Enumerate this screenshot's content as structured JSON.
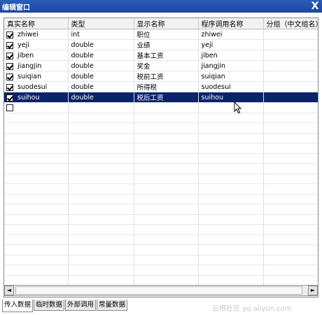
{
  "window": {
    "title": "编辑窗口",
    "close_glyph": "X"
  },
  "grid": {
    "columns": [
      "真实名称",
      "类型",
      "显示名称",
      "程序调用名称",
      "分组（中文组名）"
    ],
    "rows": [
      {
        "checked": true,
        "real_name": "zhiwei",
        "type": "int",
        "display_name": "职位",
        "program_name": "zhiwei",
        "group": ""
      },
      {
        "checked": true,
        "real_name": "yeji",
        "type": "double",
        "display_name": "业绩",
        "program_name": "yeji",
        "group": ""
      },
      {
        "checked": true,
        "real_name": "jiben",
        "type": "double",
        "display_name": "基本工资",
        "program_name": "jiben",
        "group": ""
      },
      {
        "checked": true,
        "real_name": "jiangjin",
        "type": "double",
        "display_name": "奖金",
        "program_name": "jiangjin",
        "group": ""
      },
      {
        "checked": true,
        "real_name": "suiqian",
        "type": "double",
        "display_name": "税前工资",
        "program_name": "suiqian",
        "group": ""
      },
      {
        "checked": true,
        "real_name": "suodesui",
        "type": "double",
        "display_name": "所得税",
        "program_name": "suodesui",
        "group": ""
      },
      {
        "checked": true,
        "real_name": "suihou",
        "type": "double",
        "display_name": "税后工资",
        "program_name": "suihou",
        "group": "",
        "selected": true
      },
      {
        "checked": false,
        "real_name": "",
        "type": "",
        "display_name": "",
        "program_name": "",
        "group": ""
      }
    ],
    "empty_rows": 17
  },
  "scrollbar": {
    "left_arrow": "◄",
    "right_arrow": "►"
  },
  "tabs": [
    {
      "label": "传入数据",
      "active": true
    },
    {
      "label": "临时数据",
      "active": false
    },
    {
      "label": "外部调用",
      "active": false
    },
    {
      "label": "常量数据",
      "active": false
    }
  ],
  "watermark": "云栖社区 yq.aliyun.com"
}
